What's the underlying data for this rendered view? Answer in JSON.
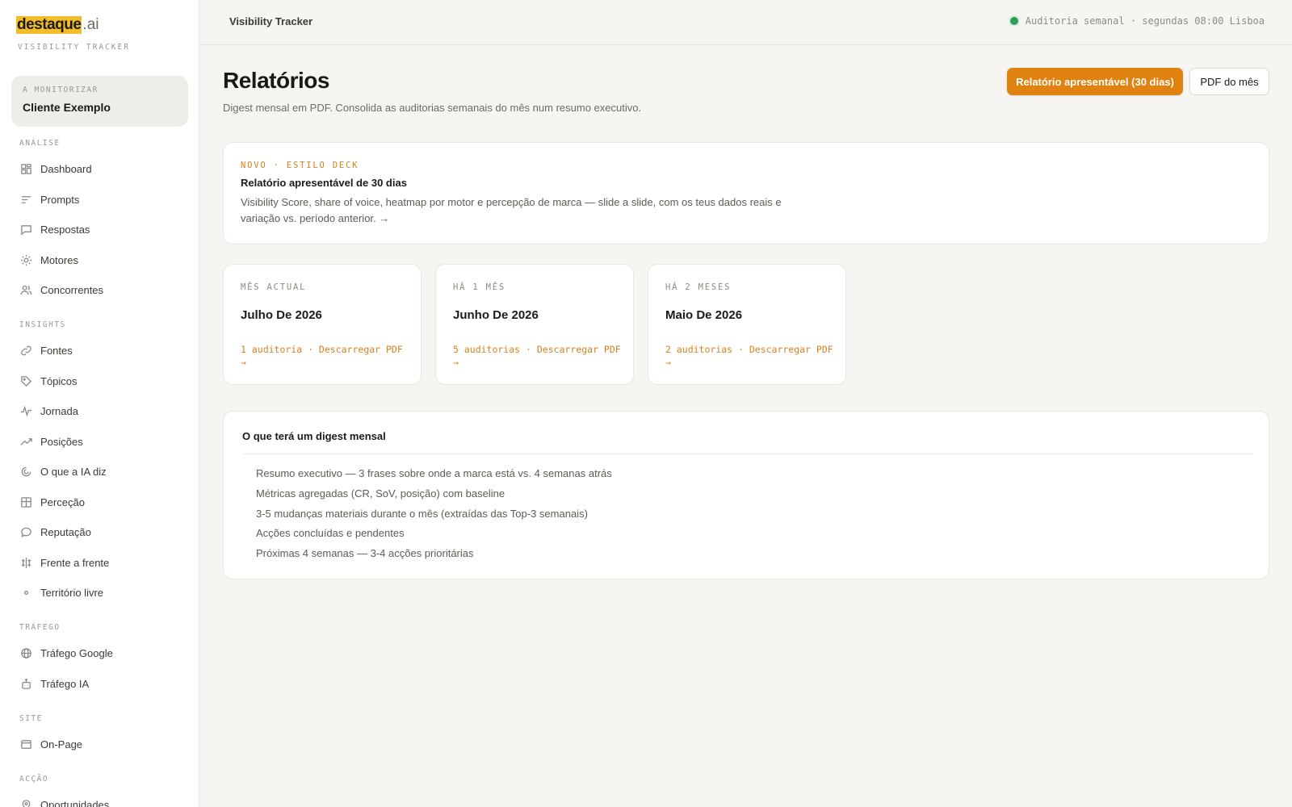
{
  "brand": {
    "name": "destaque",
    "tld": ".ai",
    "subtitle": "VISIBILITY TRACKER"
  },
  "client": {
    "label": "A MONITORIZAR",
    "name": "Cliente Exemplo"
  },
  "sidebar": {
    "sections": [
      {
        "title": "ANÁLISE",
        "items": [
          {
            "label": "Dashboard",
            "icon": "grid-icon"
          },
          {
            "label": "Prompts",
            "icon": "lines-icon"
          },
          {
            "label": "Respostas",
            "icon": "chat-icon"
          },
          {
            "label": "Motores",
            "icon": "sun-icon"
          },
          {
            "label": "Concorrentes",
            "icon": "users-icon"
          }
        ]
      },
      {
        "title": "INSIGHTS",
        "items": [
          {
            "label": "Fontes",
            "icon": "link-icon"
          },
          {
            "label": "Tópicos",
            "icon": "tag-icon"
          },
          {
            "label": "Jornada",
            "icon": "pulse-icon"
          },
          {
            "label": "Posições",
            "icon": "trend-icon"
          },
          {
            "label": "O que a IA diz",
            "icon": "spiral-icon"
          },
          {
            "label": "Perceção",
            "icon": "layout-icon"
          },
          {
            "label": "Reputação",
            "icon": "bubble-icon"
          },
          {
            "label": "Frente a frente",
            "icon": "compare-icon"
          },
          {
            "label": "Território livre",
            "icon": "dot-icon"
          }
        ]
      },
      {
        "title": "TRÁFEGO",
        "items": [
          {
            "label": "Tráfego Google",
            "icon": "globe-icon"
          },
          {
            "label": "Tráfego IA",
            "icon": "bot-icon"
          }
        ]
      },
      {
        "title": "SITE",
        "items": [
          {
            "label": "On-Page",
            "icon": "window-icon"
          }
        ]
      },
      {
        "title": "ACÇÃO",
        "items": [
          {
            "label": "Oportunidades",
            "icon": "pin-icon"
          }
        ]
      }
    ]
  },
  "topbar": {
    "title": "Visibility Tracker",
    "status": "Auditoria semanal · segundas 08:00 Lisboa",
    "status_color": "#2f9e55"
  },
  "page": {
    "title": "Relatórios",
    "subtitle": "Digest mensal em PDF. Consolida as auditorias semanais do mês num resumo executivo.",
    "primary_button": "Relatório apresentável (30 dias)",
    "secondary_button": "PDF do mês"
  },
  "promo": {
    "kicker": "NOVO · ESTILO DECK",
    "title": "Relatório apresentável de 30 dias",
    "body": "Visibility Score, share of voice, heatmap por motor e percepção de marca — slide a slide, com os teus dados reais e variação vs. período anterior. →"
  },
  "months": [
    {
      "kicker": "MÊS ACTUAL",
      "title": "Julho De 2026",
      "link": "1 auditoria · Descarregar PDF →"
    },
    {
      "kicker": "HÁ 1 MÊS",
      "title": "Junho De 2026",
      "link": "5 auditorias · Descarregar PDF →"
    },
    {
      "kicker": "HÁ 2 MESES",
      "title": "Maio De 2026",
      "link": "2 auditorias · Descarregar PDF →"
    }
  ],
  "digest": {
    "title": "O que terá um digest mensal",
    "items": [
      "Resumo executivo — 3 frases sobre onde a marca está vs. 4 semanas atrás",
      "Métricas agregadas (CR, SoV, posição) com baseline",
      "3-5 mudanças materiais durante o mês (extraídas das Top-3 semanais)",
      "Acções concluídas e pendentes",
      "Próximas 4 semanas — 3-4 acções prioritárias"
    ]
  },
  "colors": {
    "accent": "#e0820f",
    "brand_highlight": "#f2bd2a",
    "background": "#f6f5f1"
  }
}
